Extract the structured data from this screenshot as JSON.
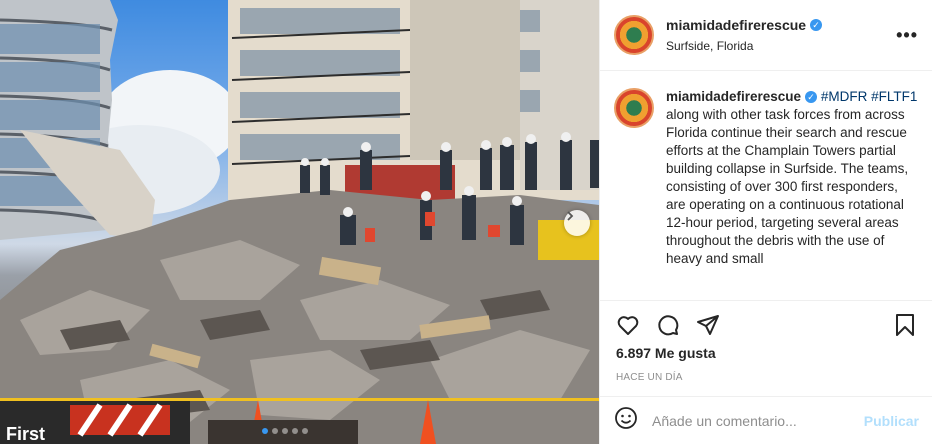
{
  "post": {
    "username": "miamidadefirerescue",
    "location": "Surfside, Florida",
    "more_icon": "more-horizontal-icon",
    "caption": {
      "username": "miamidadefirerescue",
      "hashtag1": "#MDFR",
      "hashtag2": "#FLTF1",
      "text": "along with other task forces from across Florida continue their search and rescue efforts at the Champlain Towers partial building collapse in Surfside. The teams, consisting of over 300 first responders, are operating on a continuous rotational 12-hour period, targeting several areas throughout the debris with the use of heavy and small"
    },
    "likes": "6.897 Me gusta",
    "timestamp": "HACE UN DÍA",
    "comment_placeholder": "Añade un comentario...",
    "publish_label": "Publicar",
    "photo_sign_text": "First",
    "carousel": {
      "current": 1,
      "total": 5
    }
  },
  "icons": [
    "heart-icon",
    "comment-icon",
    "share-icon",
    "bookmark-icon",
    "emoji-icon",
    "verified-icon",
    "chevron-right-icon"
  ],
  "colors": {
    "accent": "#3897f0",
    "publish": "#b2dffc",
    "hashtag": "#00376b",
    "border": "#efefef"
  }
}
